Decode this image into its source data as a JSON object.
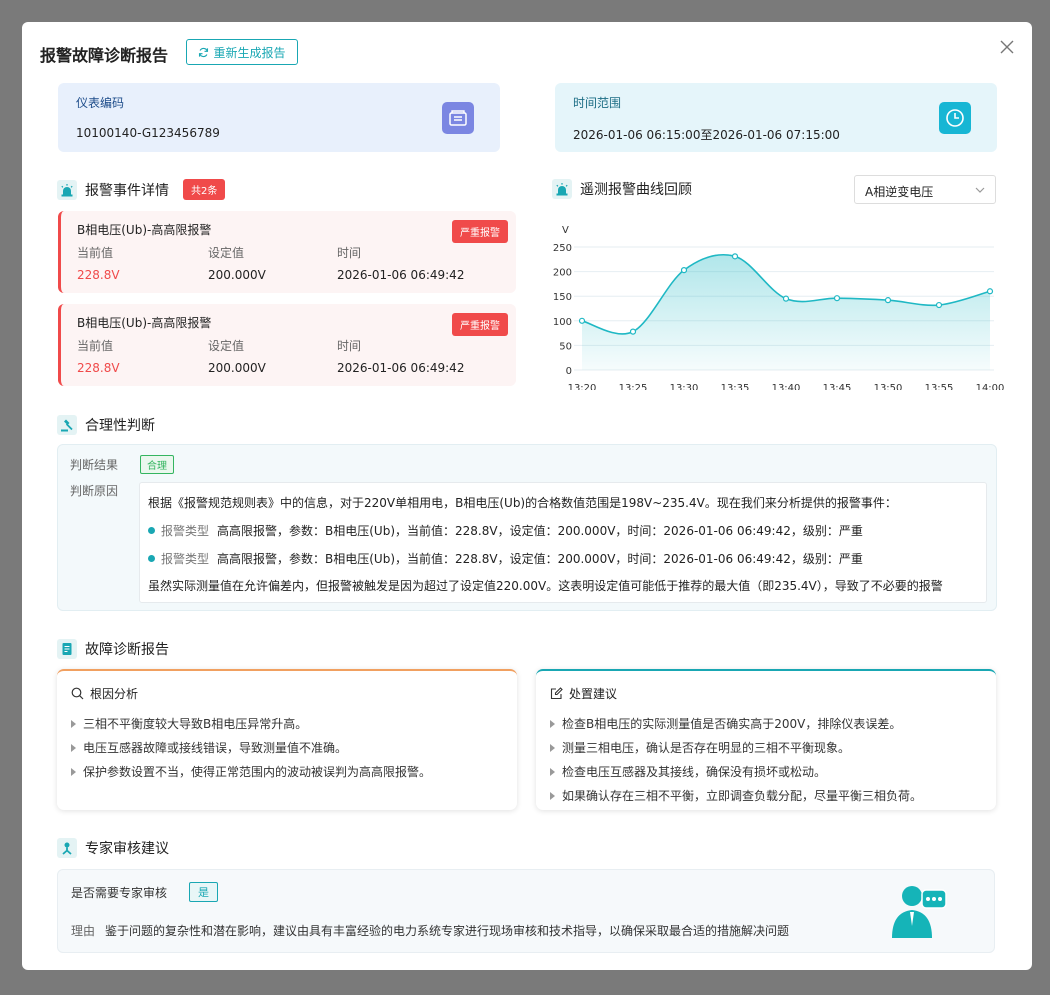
{
  "header": {
    "title": "报警故障诊断报告",
    "regen_label": "重新生成报告"
  },
  "meter": {
    "label": "仪表编码",
    "value": "10100140-G123456789"
  },
  "time_range": {
    "label": "时间范围",
    "value": "2026-01-06 06:15:00至2026-01-06 07:15:00"
  },
  "events": {
    "title": "报警事件详情",
    "count": "共2条",
    "col_current": "当前值",
    "col_setpoint": "设定值",
    "col_time": "时间",
    "items": [
      {
        "name": "B相电压(Ub)-高高限报警",
        "severity": "严重报警",
        "current": "228.8V",
        "setpoint": "200.000V",
        "time": "2026-01-06 06:49:42"
      },
      {
        "name": "B相电压(Ub)-高高限报警",
        "severity": "严重报警",
        "current": "228.8V",
        "setpoint": "200.000V",
        "time": "2026-01-06 06:49:42"
      }
    ]
  },
  "curve": {
    "title": "遥测报警曲线回顾",
    "selected": "A相逆变电压"
  },
  "chart_data": {
    "type": "area",
    "ylabel": "V",
    "ylim": [
      0,
      250
    ],
    "yticks": [
      0,
      50,
      100,
      150,
      200,
      250
    ],
    "categories": [
      "13:20",
      "13:25",
      "13:30",
      "13:35",
      "13:40",
      "13:45",
      "13:50",
      "13:55",
      "14:00"
    ],
    "points": [
      {
        "x": "13:20",
        "y": 100
      },
      {
        "x": "13:25",
        "y": 78
      },
      {
        "x": "13:30",
        "y": 203
      },
      {
        "x": "13:35",
        "y": 231
      },
      {
        "x": "13:40",
        "y": 145
      },
      {
        "x": "13:45",
        "y": 146
      },
      {
        "x": "13:50",
        "y": 142
      },
      {
        "x": "13:55",
        "y": 132
      },
      {
        "x": "14:00",
        "y": 160
      }
    ],
    "grid": true,
    "color": "#1fb8c4"
  },
  "judgement": {
    "title": "合理性判断",
    "result_label": "判断结果",
    "result_value": "合理",
    "reason_label": "判断原因",
    "intro": "根据《报警规范规则表》中的信息，对于220V单相用电，B相电压(Ub)的合格数值范围是198V~235.4V。现在我们来分析提供的报警事件：",
    "events": [
      {
        "type": "报警类型",
        "text": "高高限报警，参数：B相电压(Ub)，当前值：228.8V，设定值：200.000V，时间：2026-01-06 06:49:42，级别：严重"
      },
      {
        "type": "报警类型",
        "text": "高高限报警，参数：B相电压(Ub)，当前值：228.8V，设定值：200.000V，时间：2026-01-06 06:49:42，级别：严重"
      }
    ],
    "conclusion": "虽然实际测量值在允许偏差内，但报警被触发是因为超过了设定值220.00V。这表明设定值可能低于推荐的最大值（即235.4V），导致了不必要的报警"
  },
  "diagnosis": {
    "title": "故障诊断报告",
    "root": {
      "title": "根因分析",
      "items": [
        "三相不平衡度较大导致B相电压异常升高。",
        "电压互感器故障或接线错误，导致测量值不准确。",
        "保护参数设置不当，使得正常范围内的波动被误判为高高限报警。"
      ]
    },
    "action": {
      "title": "处置建议",
      "items": [
        "检查B相电压的实际测量值是否确实高于200V，排除仪表误差。",
        "测量三相电压，确认是否存在明显的三相不平衡现象。",
        "检查电压互感器及其接线，确保没有损坏或松动。",
        "如果确认存在三相不平衡，立即调查负载分配，尽量平衡三相负荷。"
      ]
    }
  },
  "expert": {
    "title": "专家审核建议",
    "need_label": "是否需要专家审核",
    "need_value": "是",
    "reason_label": "理由",
    "reason_text": "鉴于问题的复杂性和潜在影响，建议由具有丰富经验的电力系统专家进行现场审核和技术指导，以确保采取最合适的措施解决问题"
  },
  "colors": {
    "accent": "#19a7b3",
    "danger": "#f04a4a",
    "success": "#34b560"
  }
}
